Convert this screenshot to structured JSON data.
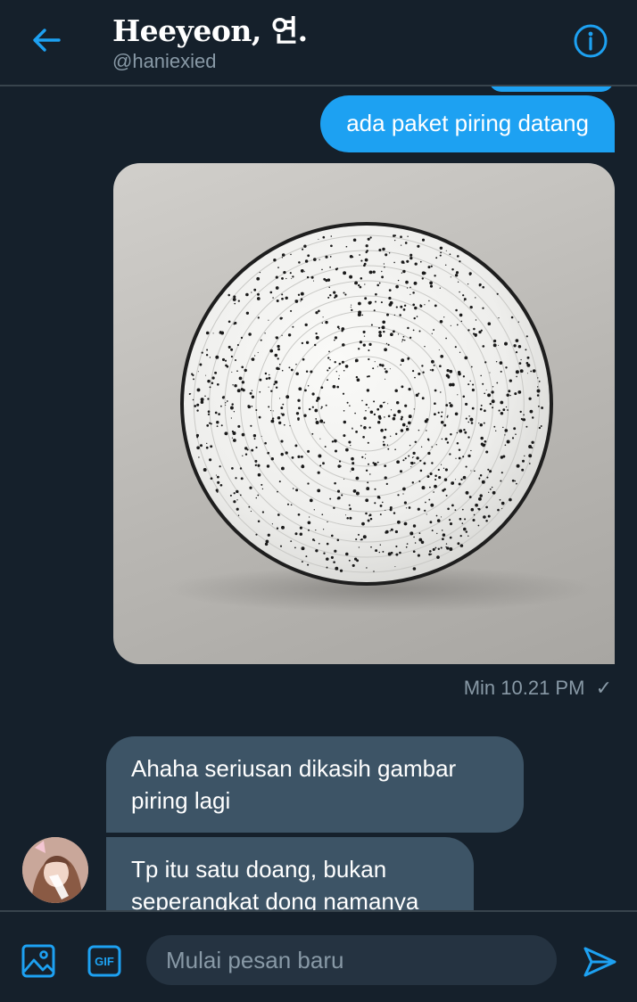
{
  "header": {
    "title": "Heeyeon, 연.",
    "handle": "@haniexied"
  },
  "icons": {
    "back": "arrow-left-icon",
    "info": "info-icon",
    "media": "image-icon",
    "gif": "gif-icon",
    "send": "send-icon",
    "read_receipt": "checkmark-icon"
  },
  "colors": {
    "accent": "#1da1f2",
    "background": "#15202b",
    "received_bubble": "#3d5466",
    "secondary_text": "#8899a6",
    "divider": "#38444d"
  },
  "thread": {
    "sent_message": "ada paket piring datang",
    "sent_time": "Min 10.21 PM",
    "sent_status": "✓",
    "received": [
      {
        "text": "Ahaha seriusan dikasih gambar piring lagi"
      },
      {
        "text": "Tp itu satu doang, bukan seperangkat dong namanya 😂"
      }
    ]
  },
  "composer": {
    "gif_label": "GIF",
    "placeholder": "Mulai pesan baru"
  }
}
